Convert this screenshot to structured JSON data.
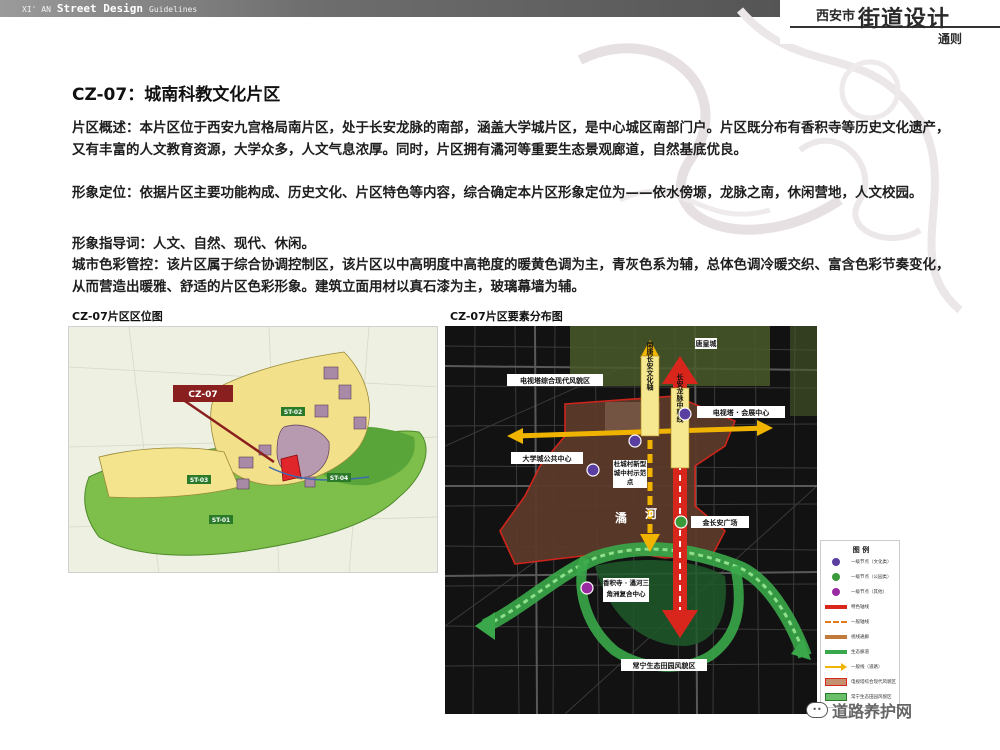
{
  "header": {
    "prefix": "XI' AN",
    "brand": "Street Design",
    "suffix": "Guidelines",
    "city": "西安市",
    "main_title": "街道设计",
    "sub_title": "通则"
  },
  "section": {
    "title": "CZ-07：城南科教文化片区",
    "overview": "片区概述：本片区位于西安九宫格局南片区，处于长安龙脉的南部，涵盖大学城片区，是中心城区南部门户。片区既分布有香积寺等历史文化遗产，又有丰富的人文教育资源，大学众多，人文气息浓厚。同时，片区拥有潏河等重要生态景观廊道，自然基底优良。",
    "positioning": "形象定位：依据片区主要功能构成、历史文化、片区特色等内容，综合确定本片区形象定位为——依水傍塬，龙脉之南，休闲营地，人文校园。",
    "keywords": "形象指导词：人文、自然、现代、休闲。",
    "color_control": "城市色彩管控：该片区属于综合协调控制区，该片区以中高明度中高艳度的暖黄色调为主，青灰色系为辅，总体色调冷暖交织、富含色彩节奏变化，从而营造出暖雅、舒适的片区色彩形象。建筑立面用材以真石漆为主，玻璃幕墙为辅。"
  },
  "map_location": {
    "caption": "CZ-07片区区位图",
    "callout": "CZ-07",
    "zones": [
      "ST-01",
      "ST-02",
      "ST-03",
      "ST-04"
    ]
  },
  "map_elements": {
    "caption": "CZ-07片区要素分布图",
    "labels": {
      "huangcheng": "唐皇城",
      "tv_tower": "电视塔综合现代风貌区",
      "tv_node": "电视塔 · 会展中心",
      "univ_center": "大学城公共中心",
      "dujiang": "杜城村新型城中村示范点",
      "jinchang": "金长安广场",
      "xiangji": "香积寺 · 潏河三角洲复合中心",
      "changning": "常宁生态田园风貌区",
      "north_axis": "南唐长安文化轴",
      "long_axis": "长安龙脉中轴线",
      "river_a": "潏",
      "river_b": "河"
    },
    "legend_title": "图 例",
    "legend": [
      "一级节点（文化类）",
      "一级节点（公园类）",
      "一级节点（其他）",
      "特色轴线",
      "一般轴线",
      "视线通廊",
      "生态廊道",
      "一般线（道路）",
      "电视塔综合现代风貌区",
      "常宁生态田园风貌区"
    ]
  },
  "watermark": "道路养护网",
  "colors": {
    "header_gray": "#6e6e6e",
    "callout_red": "#8a1f1f",
    "axis_red": "#d9261c",
    "axis_yellow": "#f0b400",
    "eco_green": "#3aa84a",
    "district_brown": "#5b3a2a",
    "node_purple": "#5b3fa0",
    "node_green": "#3a9a3a"
  }
}
